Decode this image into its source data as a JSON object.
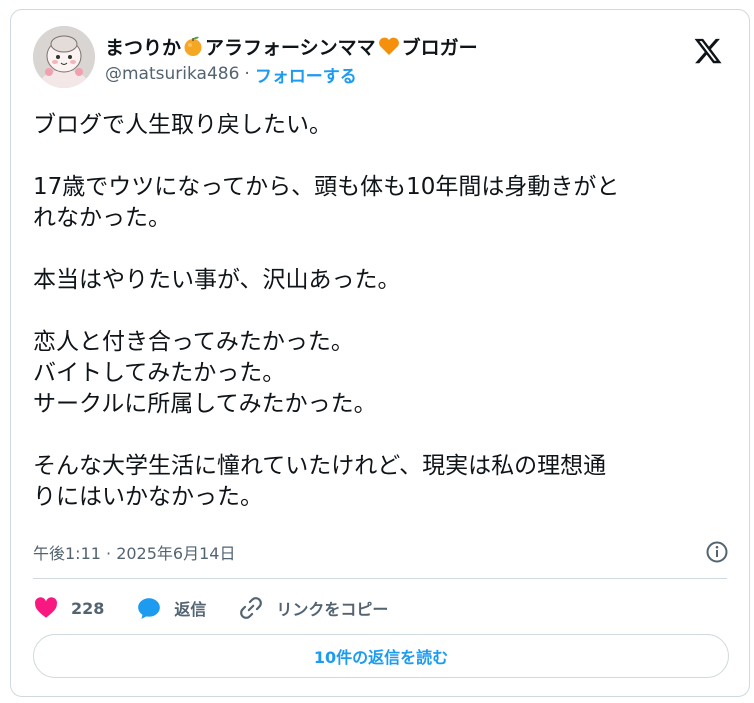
{
  "author": {
    "name_part1": "まつりか",
    "name_part2": "アラフォーシンママ",
    "name_part3": "ブロガー",
    "handle": "@matsurika486",
    "separator": "·",
    "follow_label": "フォローする"
  },
  "post": {
    "lines": [
      "ブログで人生取り戻したい。",
      "",
      "17歳でウツになってから、頭も体も10年間は身動きがと",
      "れなかった。",
      "",
      "本当はやりたい事が、沢山あった。",
      "",
      "恋人と付き合ってみたかった。",
      "バイトしてみたかった。",
      "サークルに所属してみたかった。",
      "",
      "そんな大学生活に憧れていたけれど、現実は私の理想通",
      "りにはいかなかった。"
    ],
    "timestamp": "午後1:11 · 2025年6月14日"
  },
  "actions": {
    "like_count": "228",
    "reply_label": "返信",
    "copy_link_label": "リンクをコピー"
  },
  "replies_button": "10件の返信を読む",
  "colors": {
    "accent": "#1d9bf0",
    "like": "#f91880",
    "muted": "#536471",
    "border": "#cfd9de"
  },
  "icons": {
    "logo": "x-logo-icon",
    "info": "info-icon",
    "like": "heart-icon",
    "reply": "speech-bubble-icon",
    "copy_link": "link-icon",
    "emoji1": "orange-emoji-icon",
    "emoji2": "orange-heart-emoji-icon"
  }
}
